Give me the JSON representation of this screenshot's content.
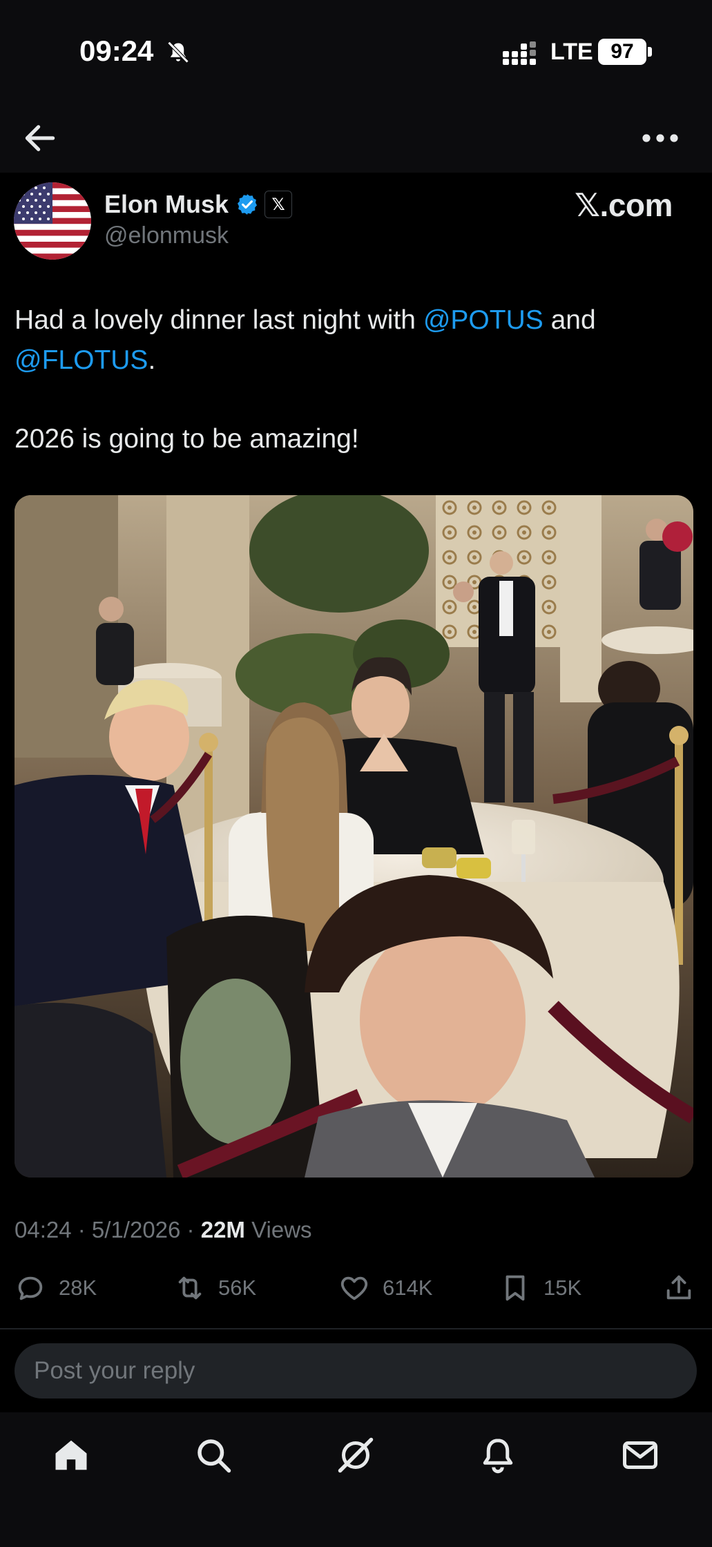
{
  "status_bar": {
    "time": "09:24",
    "network": "LTE",
    "battery": "97"
  },
  "post": {
    "author": {
      "display_name": "Elon Musk",
      "handle": "@elonmusk",
      "affiliate_badge": "𝕏"
    },
    "brand": "𝕏.com",
    "text": {
      "part1": "Had a lovely dinner last night with ",
      "mention1": "@POTUS",
      "part2": " and ",
      "mention2": "@FLOTUS",
      "part3": ".",
      "line2": "2026 is going to be amazing!"
    },
    "meta": {
      "time": "04:24",
      "sep1": " · ",
      "date": "5/1/2026",
      "sep2": " · ",
      "views_count": "22M",
      "views_label": " Views"
    },
    "actions": {
      "replies": "28K",
      "reposts": "56K",
      "likes": "614K",
      "bookmarks": "15K"
    }
  },
  "reply": {
    "placeholder": "Post your reply"
  },
  "icons": {
    "back": "arrow-left-icon",
    "more": "ellipsis-icon",
    "verified": "verified-badge-icon",
    "home": "home-icon",
    "search": "search-icon",
    "grok": "grok-icon",
    "notifications": "bell-icon",
    "messages": "mail-icon"
  },
  "colors": {
    "background": "#000000",
    "accent": "#1d9bf0",
    "secondary_text": "#71767b",
    "primary_text": "#e7e9ea"
  }
}
